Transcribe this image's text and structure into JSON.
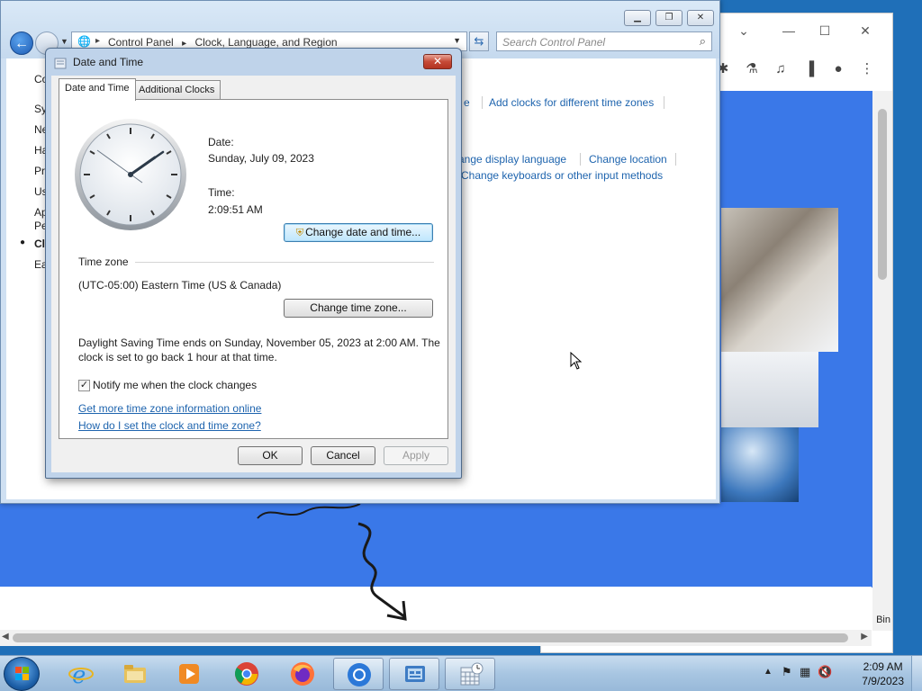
{
  "browser": {
    "tb_icons": [
      "puzzle-icon",
      "flask-icon",
      "playlist-icon",
      "sidebar-icon",
      "profile-icon",
      "more-icon"
    ],
    "bin_label": "Bin"
  },
  "control_panel": {
    "breadcrumb": [
      "Control Panel",
      "Clock, Language, and Region"
    ],
    "search_placeholder": "Search Control Panel",
    "left_items": [
      "Co",
      "Sy",
      "Ne",
      "Ha",
      "Pr",
      "Us",
      "Ap",
      "Pe",
      "Cl",
      "Ea"
    ],
    "links": {
      "partial_e": "e",
      "add_clocks": "Add clocks for different time zones",
      "change_display_language": "ange display language",
      "change_location": "Change location",
      "change_keyboards": "Change keyboards or other input methods"
    }
  },
  "dialog": {
    "title": "Date and Time",
    "tabs": [
      "Date and Time",
      "Additional Clocks"
    ],
    "date_label": "Date:",
    "date_value": "Sunday, July 09, 2023",
    "time_label": "Time:",
    "time_value": "2:09:51 AM",
    "change_date_btn": "Change date and time...",
    "tz_heading": "Time zone",
    "tz_value": "(UTC-05:00) Eastern Time (US & Canada)",
    "change_tz_btn": "Change time zone...",
    "dst_line1": "Daylight Saving Time ends on Sunday, November 05, 2023 at 2:00 AM. The",
    "dst_line2": "clock is set to go back 1 hour at that time.",
    "notify_label": "Notify me when the clock changes",
    "notify_checked": true,
    "link_more_info": "Get more time zone information online",
    "link_how_set": "How do I set the clock and time zone?",
    "ok": "OK",
    "cancel": "Cancel",
    "apply": "Apply"
  },
  "taskbar": {
    "clock_time": "2:09 AM",
    "clock_date": "7/9/2023",
    "apps": [
      "internet-explorer",
      "file-explorer",
      "media-player",
      "chrome",
      "firefox",
      "chromium",
      "control-panel",
      "date-and-time"
    ]
  }
}
